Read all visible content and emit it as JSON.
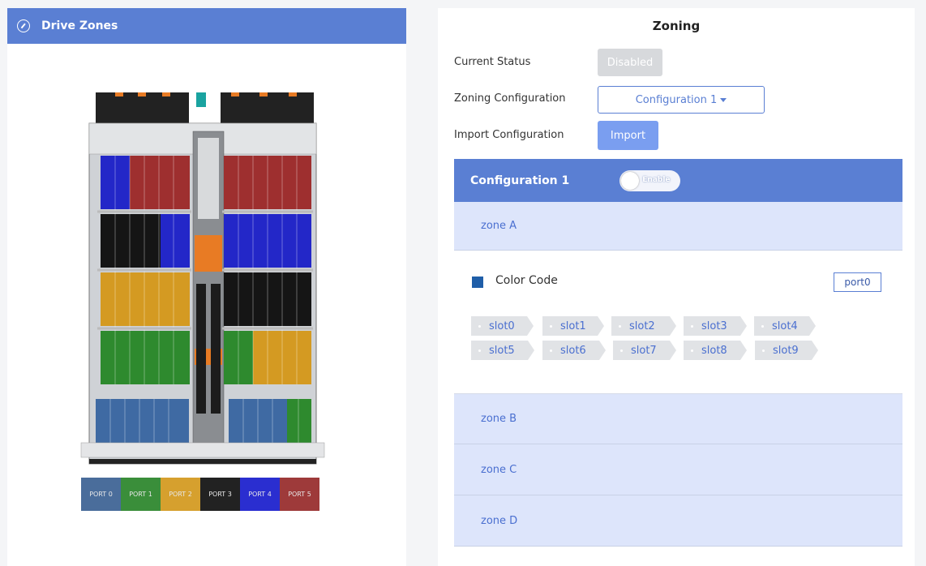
{
  "left": {
    "title": "Drive Zones",
    "ports": [
      {
        "label": "PORT 0",
        "color": "#4a6d9b"
      },
      {
        "label": "PORT 1",
        "color": "#3a8e3a"
      },
      {
        "label": "PORT 2",
        "color": "#d6a02e"
      },
      {
        "label": "PORT 3",
        "color": "#222222"
      },
      {
        "label": "PORT 4",
        "color": "#2a2ed0"
      },
      {
        "label": "PORT 5",
        "color": "#9e3a3a"
      }
    ]
  },
  "right": {
    "title": "Zoning",
    "current_status_label": "Current Status",
    "current_status_value": "Disabled",
    "zoning_config_label": "Zoning Configuration",
    "zoning_config_value": "Configuration 1",
    "import_label": "Import Configuration",
    "import_button": "Import",
    "config_header": "Configuration 1",
    "enable_label": "Enable",
    "zones": [
      "zone A",
      "zone B",
      "zone C",
      "zone D"
    ],
    "expanded": {
      "color_code_label": "Color Code",
      "color": "#1f5ea8",
      "port": "port0",
      "slots": [
        "slot0",
        "slot1",
        "slot2",
        "slot3",
        "slot4",
        "slot5",
        "slot6",
        "slot7",
        "slot8",
        "slot9"
      ]
    }
  },
  "colors": {
    "accent": "#5a7fd3",
    "zone_bg": "#dde5fb"
  }
}
